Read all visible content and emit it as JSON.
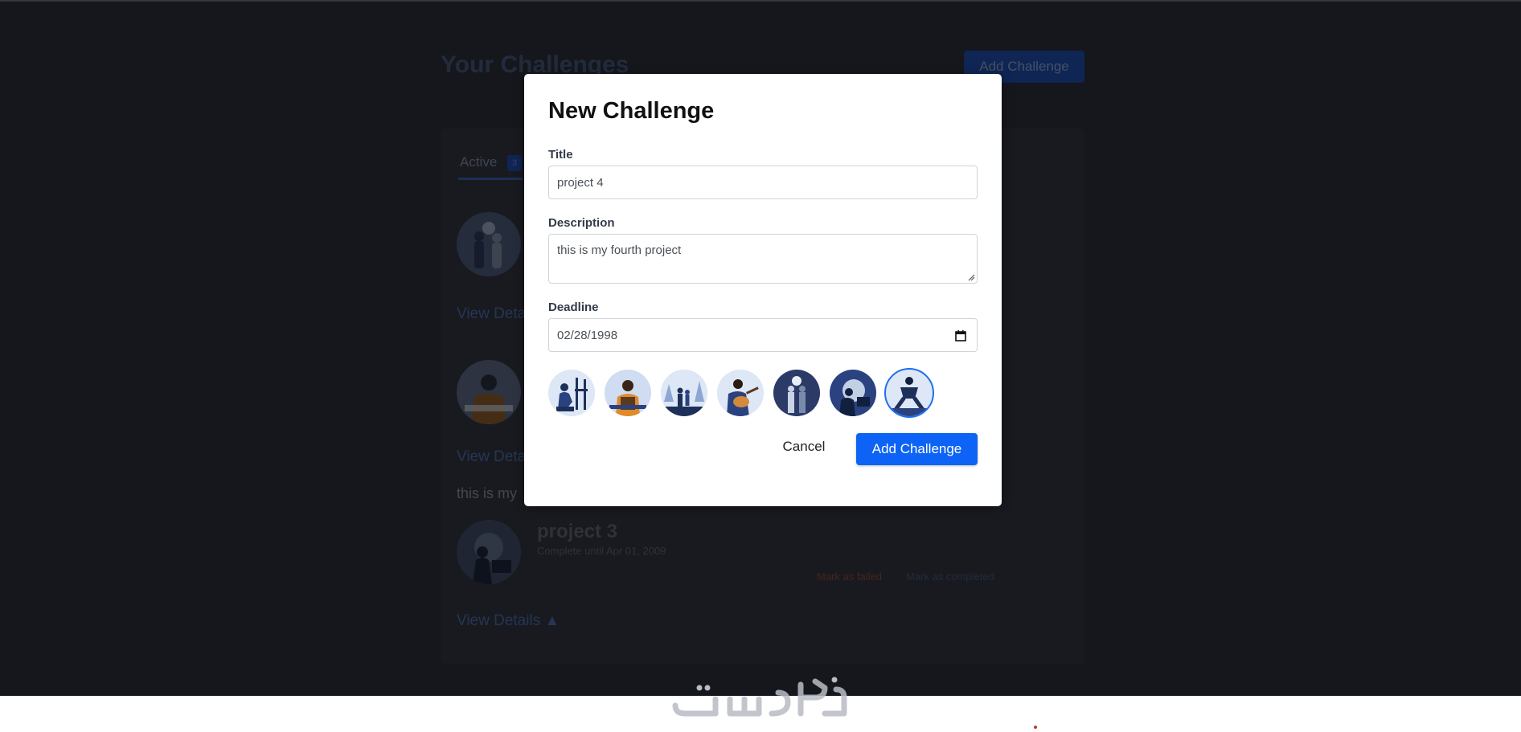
{
  "background": {
    "page_title": "Your Challenges",
    "add_button": "Add Challenge",
    "tabs": [
      {
        "label": "Active",
        "count": "3"
      }
    ],
    "items": [
      {
        "link": "View Deta"
      },
      {
        "link": "View Deta",
        "description": "this is my"
      },
      {
        "title": "project 3",
        "subtitle": "Complete until Apr 01, 2009",
        "mark_failed": "Mark as failed",
        "mark_completed": "Mark as completed",
        "link": "View Details ▲"
      }
    ]
  },
  "modal": {
    "title": "New Challenge",
    "fields": {
      "title": {
        "label": "Title",
        "value": "project 4"
      },
      "description": {
        "label": "Description",
        "value": "this is my fourth project"
      },
      "deadline": {
        "label": "Deadline",
        "value": "02/28/1998"
      }
    },
    "avatars": [
      {
        "name": "painter-avatar",
        "selected": false
      },
      {
        "name": "craftsman-avatar",
        "selected": false
      },
      {
        "name": "family-walk-avatar",
        "selected": false
      },
      {
        "name": "guitarist-avatar",
        "selected": false
      },
      {
        "name": "couple-avatar",
        "selected": false
      },
      {
        "name": "desk-worker-avatar",
        "selected": false
      },
      {
        "name": "athlete-avatar",
        "selected": true
      }
    ],
    "cancel_label": "Cancel",
    "submit_label": "Add Challenge"
  },
  "colors": {
    "primary": "#0d63f5",
    "overlay": "rgba(0,0,0,0.50)",
    "app_background": "#2b2f38"
  }
}
